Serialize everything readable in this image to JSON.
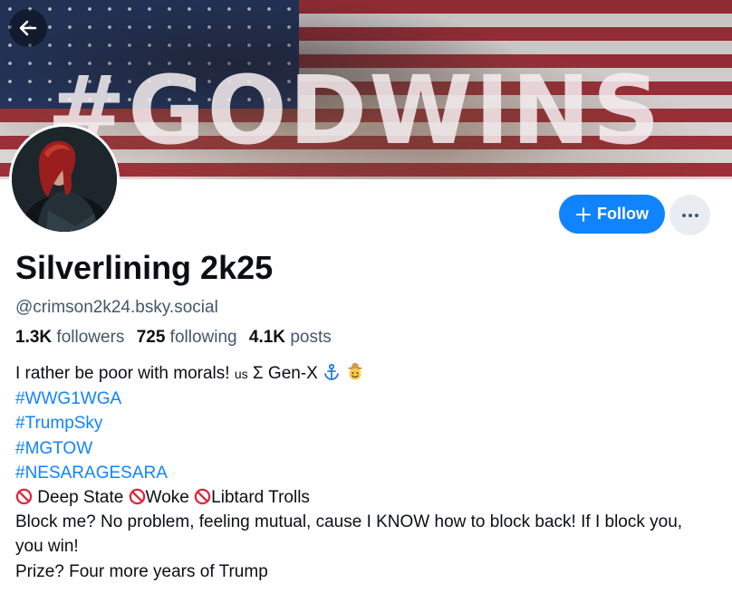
{
  "banner": {
    "hashtag_text": "#GODWINS",
    "colors": {
      "stripe_red": "#a8323c",
      "stripe_white": "#e9e3e3",
      "union_blue": "#273a64"
    }
  },
  "nav": {
    "back_icon": "arrow-left-icon"
  },
  "profile": {
    "display_name": "Silverlining 2k25",
    "handle": "@crimson2k24.bsky.social",
    "follow_label": "Follow",
    "follow_icon": "plus-icon",
    "more_icon": "ellipsis-icon",
    "accent_color": "#1083fe"
  },
  "stats": {
    "followers_count": "1.3K",
    "followers_label": "followers",
    "following_count": "725",
    "following_label": "following",
    "posts_count": "4.1K",
    "posts_label": "posts"
  },
  "bio": {
    "line1_text": "I rather be poor with morals! ",
    "line1_us": "us",
    "line1_sigma": " Σ Gen-X ",
    "line1_icons": [
      "anchor-icon",
      "cowboy-face-icon"
    ],
    "hashtags": [
      "#WWG1WGA",
      "#TrumpSky",
      "#MGTOW",
      "#NESARAGESARA"
    ],
    "prohibited": {
      "icon": "no-entry-sign-icon",
      "items": [
        "Deep State",
        "Woke",
        "Libtard Trolls"
      ]
    },
    "block_text": "Block me?  No problem, feeling mutual, cause I KNOW how to block back! If I block you, you win!",
    "prize_text": "Prize? Four more years of Trump"
  }
}
